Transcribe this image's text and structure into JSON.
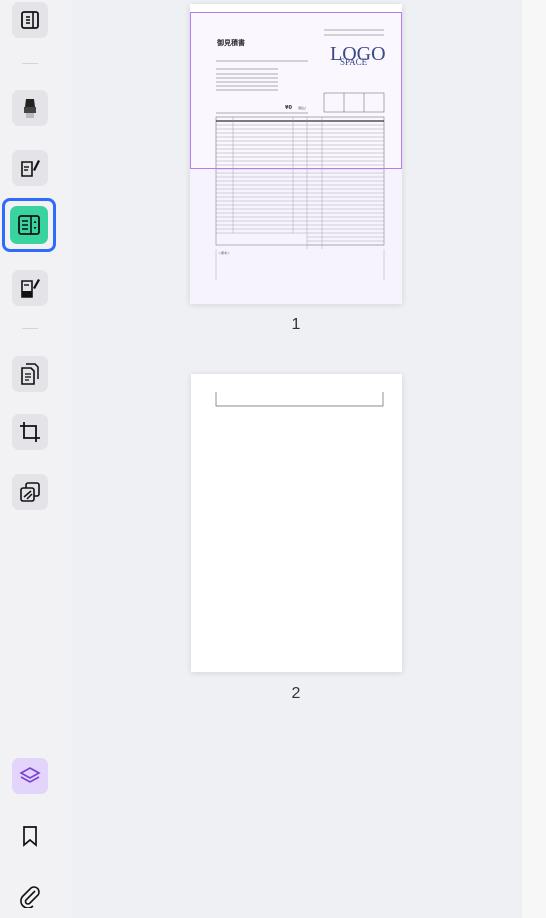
{
  "toolbar": {
    "tools": [
      {
        "name": "read-mode",
        "icon": "book-icon"
      },
      {
        "name": "highlight",
        "icon": "highlighter-icon"
      },
      {
        "name": "edit-text",
        "icon": "edit-document-icon"
      },
      {
        "name": "organize-pages",
        "icon": "page-panel-icon",
        "active": true
      },
      {
        "name": "fill-sign",
        "icon": "fill-sign-icon"
      },
      {
        "name": "convert",
        "icon": "copy-pages-icon"
      },
      {
        "name": "crop",
        "icon": "crop-icon"
      },
      {
        "name": "watermark",
        "icon": "layers-slash-icon"
      }
    ],
    "bottom": [
      {
        "name": "layers",
        "icon": "layers-icon"
      },
      {
        "name": "bookmarks",
        "icon": "bookmark-icon"
      },
      {
        "name": "attachments",
        "icon": "paperclip-icon"
      }
    ]
  },
  "thumbnails": [
    {
      "page_label": "1",
      "selected": true
    },
    {
      "page_label": "2",
      "selected": false
    }
  ],
  "doc": {
    "title": "御見積書",
    "logo_main": "LOGO",
    "logo_sub": "SPACE",
    "amount_label": "¥0",
    "amount_note": "（税込）",
    "remarks_label": "＜備考＞"
  },
  "colors": {
    "active_border": "#2f6bff",
    "active_fill": "#38d39f",
    "selection": "#b57cf0"
  }
}
